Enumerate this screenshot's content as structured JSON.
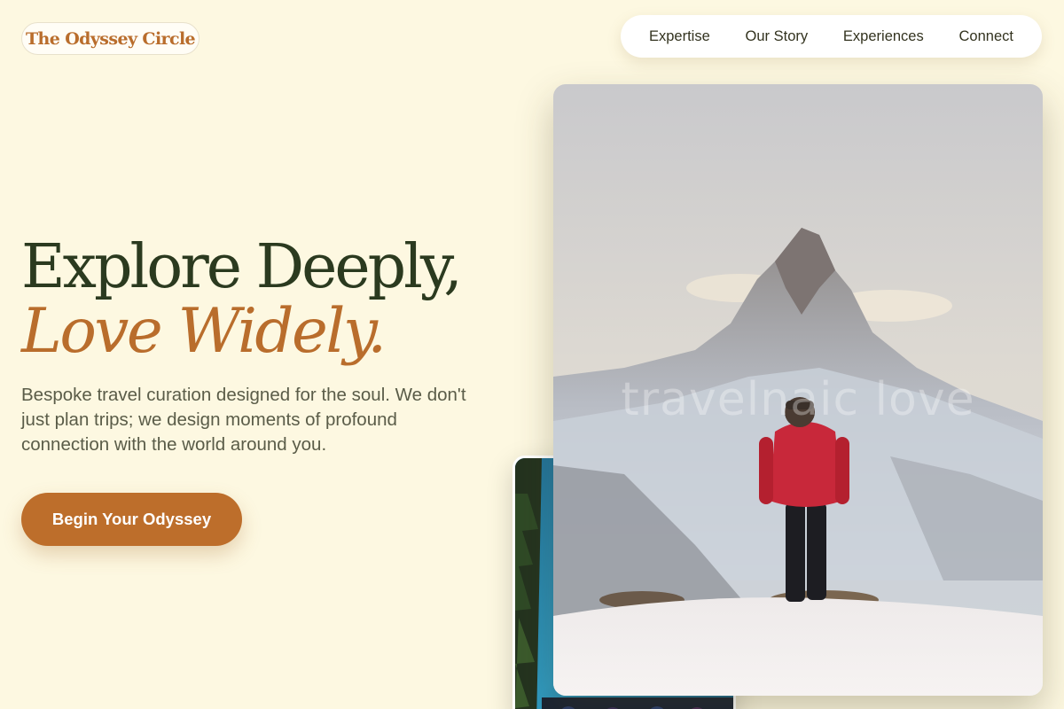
{
  "brand": {
    "name": "The Odyssey Circle",
    "color": "#b96d2c"
  },
  "nav": {
    "items": [
      "Expertise",
      "Our Story",
      "Experiences",
      "Connect"
    ]
  },
  "hero": {
    "headline_line1": "Explore Deeply,",
    "headline_line2": "Love Widely.",
    "description": "Bespoke travel curation designed for the soul. We don't just plan trips; we design moments of profound connection with the world around you.",
    "cta_label": "Begin Your Odyssey"
  },
  "images": {
    "main": {
      "subject": "Hiker in red jacket facing snowy mountain peak",
      "watermark": "travelnaic love"
    },
    "secondary": {
      "subject": "Turquoise alpine lake with pine trees"
    }
  },
  "colors": {
    "background": "#fdf8e1",
    "headline_dark": "#2b3a1f",
    "accent": "#bd6e2b",
    "body_text": "#5a5c48"
  }
}
